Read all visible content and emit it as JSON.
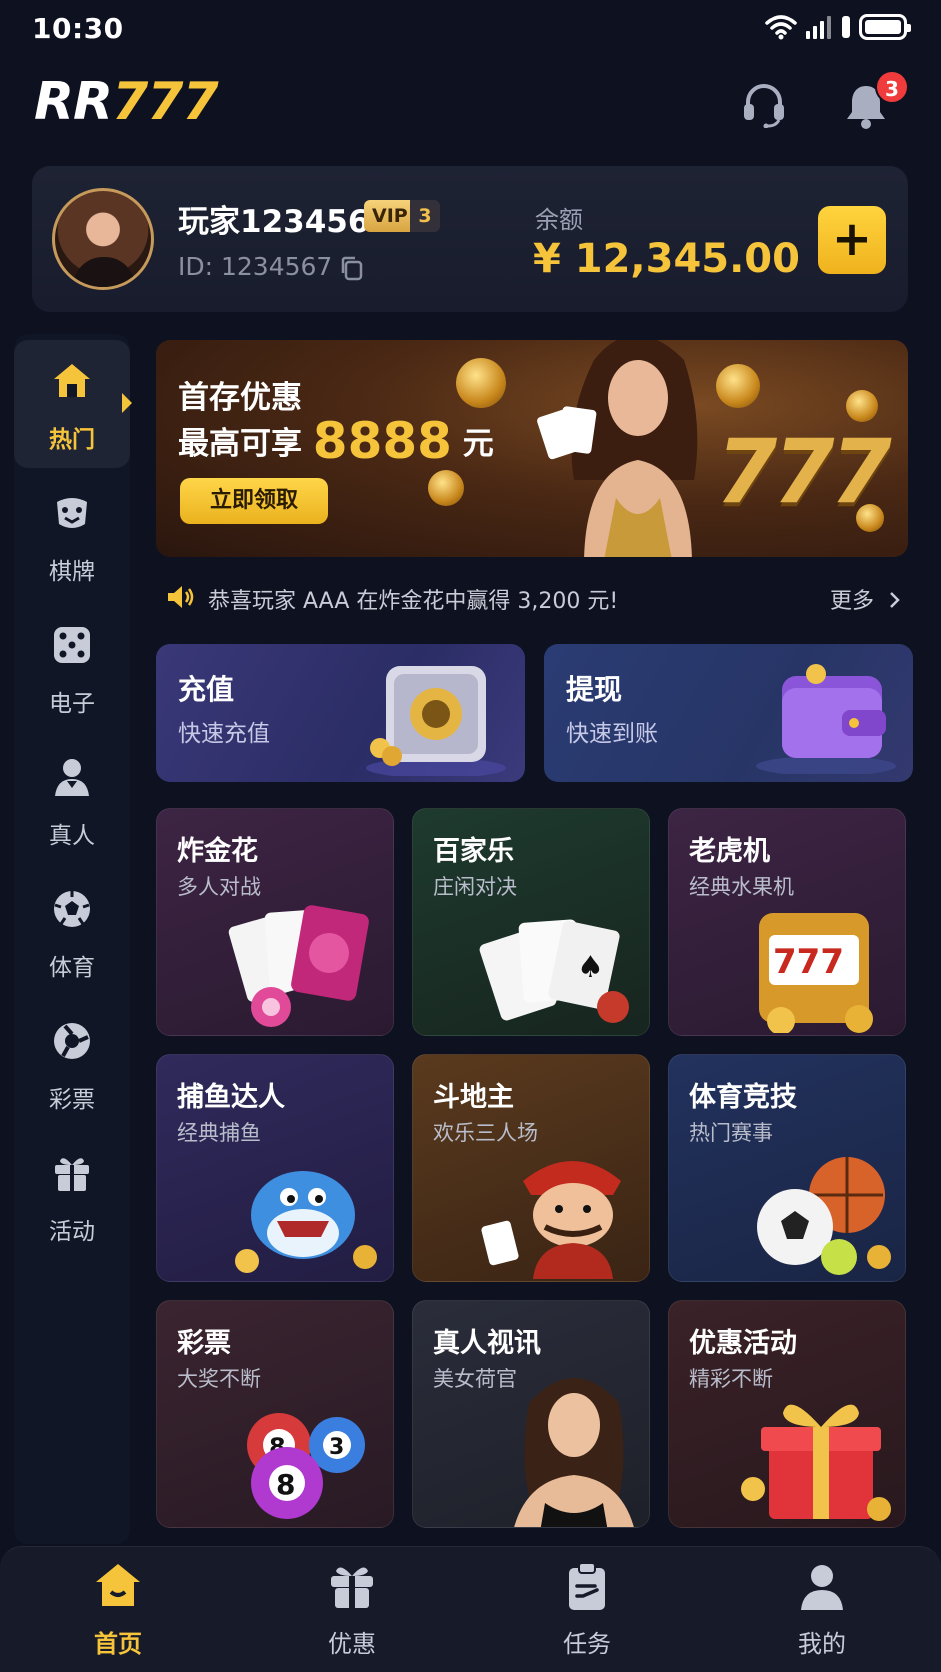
{
  "status": {
    "time": "10:30"
  },
  "header": {
    "logo_rr": "RR",
    "logo_777": "777",
    "notification_count": "3"
  },
  "user": {
    "name": "玩家123456",
    "vip_label": "VIP",
    "vip_level": "3",
    "id_text": "ID: 1234567",
    "balance_label": "余额",
    "balance": "¥ 12,345.00",
    "add_label": "+"
  },
  "sidebar": {
    "items": [
      {
        "label": "热门",
        "icon": "home-icon"
      },
      {
        "label": "棋牌",
        "icon": "cards-icon"
      },
      {
        "label": "电子",
        "icon": "dice-icon"
      },
      {
        "label": "真人",
        "icon": "dealer-icon"
      },
      {
        "label": "体育",
        "icon": "soccer-icon"
      },
      {
        "label": "彩票",
        "icon": "lottery-icon"
      },
      {
        "label": "活动",
        "icon": "gift-icon"
      }
    ]
  },
  "banner": {
    "title": "首存优惠",
    "line2_prefix": "最高可享",
    "amount": "8888",
    "unit": "元",
    "button": "立即领取",
    "decor_777": "777"
  },
  "ticker": {
    "text": "恭喜玩家 AAA 在炸金花中赢得 3,200 元!",
    "more": "更多"
  },
  "quick": [
    {
      "title": "充值",
      "subtitle": "快速充值"
    },
    {
      "title": "提现",
      "subtitle": "快速到账"
    }
  ],
  "games": [
    {
      "title": "炸金花",
      "subtitle": "多人对战"
    },
    {
      "title": "百家乐",
      "subtitle": "庄闲对决"
    },
    {
      "title": "老虎机",
      "subtitle": "经典水果机"
    },
    {
      "title": "捕鱼达人",
      "subtitle": "经典捕鱼"
    },
    {
      "title": "斗地主",
      "subtitle": "欢乐三人场"
    },
    {
      "title": "体育竞技",
      "subtitle": "热门赛事"
    },
    {
      "title": "彩票",
      "subtitle": "大奖不断"
    },
    {
      "title": "真人视讯",
      "subtitle": "美女荷官"
    },
    {
      "title": "优惠活动",
      "subtitle": "精彩不断"
    }
  ],
  "slot_reels": "777",
  "lottery_balls": [
    "8",
    "3",
    "8"
  ],
  "nav": [
    {
      "label": "首页",
      "icon": "home-icon"
    },
    {
      "label": "优惠",
      "icon": "gift-icon"
    },
    {
      "label": "任务",
      "icon": "clipboard-icon"
    },
    {
      "label": "我的",
      "icon": "user-icon"
    }
  ],
  "colors": {
    "accent": "#f6c43a",
    "background": "#0d1120",
    "badge": "#ef3b3b"
  }
}
